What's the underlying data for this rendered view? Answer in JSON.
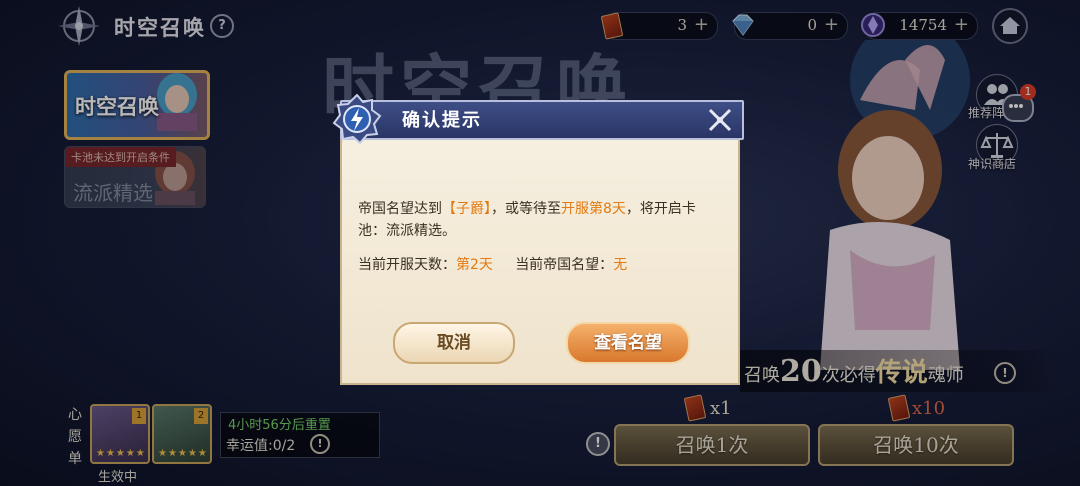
{
  "header": {
    "title": "时空召唤",
    "help_symbol": "?"
  },
  "resources": [
    {
      "name": "summon-card",
      "value": "3",
      "plus": "+"
    },
    {
      "name": "diamond",
      "value": "0",
      "plus": "+"
    },
    {
      "name": "crystal",
      "value": "14754",
      "plus": "+"
    }
  ],
  "background_title": "时空召唤",
  "tabs": [
    {
      "label": "时空召唤",
      "active": true
    },
    {
      "label": "流派精选",
      "ribbon": "卡池未达到开启条件"
    }
  ],
  "side_menu": [
    {
      "label": "推荐阵容",
      "icon": "people-icon"
    },
    {
      "label": "神识商店",
      "icon": "scales-icon"
    }
  ],
  "chat_badge_count": "1",
  "promo": {
    "prefix": "召唤",
    "count": "20",
    "middle": "次必得",
    "rarity": "传说",
    "suffix": "魂师",
    "info": "!"
  },
  "summon": {
    "single": {
      "cost": "x1",
      "label": "召唤1次"
    },
    "ten": {
      "cost": "x10",
      "label": "召唤10次"
    },
    "warn": "!"
  },
  "wishlist": {
    "label_chars": [
      "心",
      "愿",
      "单"
    ],
    "card1_tag": "1",
    "card2_tag": "2",
    "stars": "★★★★★",
    "status": "生效中",
    "reset": "4小时56分后重置",
    "luck_label": "幸运值:",
    "luck_value": "0/2",
    "info": "!"
  },
  "dialog": {
    "title": "确认提示",
    "message_parts": {
      "a": "帝国名望达到",
      "b": "【子爵】",
      "c": "，或等待至",
      "d": "开服第8天",
      "e": "，将开启卡池：流派精选。"
    },
    "stat1_label": "当前开服天数：",
    "stat1_value": "第2天",
    "stat2_label": "当前帝国名望：",
    "stat2_value": "无",
    "cancel_label": "取消",
    "confirm_label": "查看名望"
  },
  "colors": {
    "highlight": "#e47a12",
    "accent_gold": "#e4b45a",
    "dialog_header": "#2a3566",
    "dialog_body": "#f3e8d4"
  }
}
